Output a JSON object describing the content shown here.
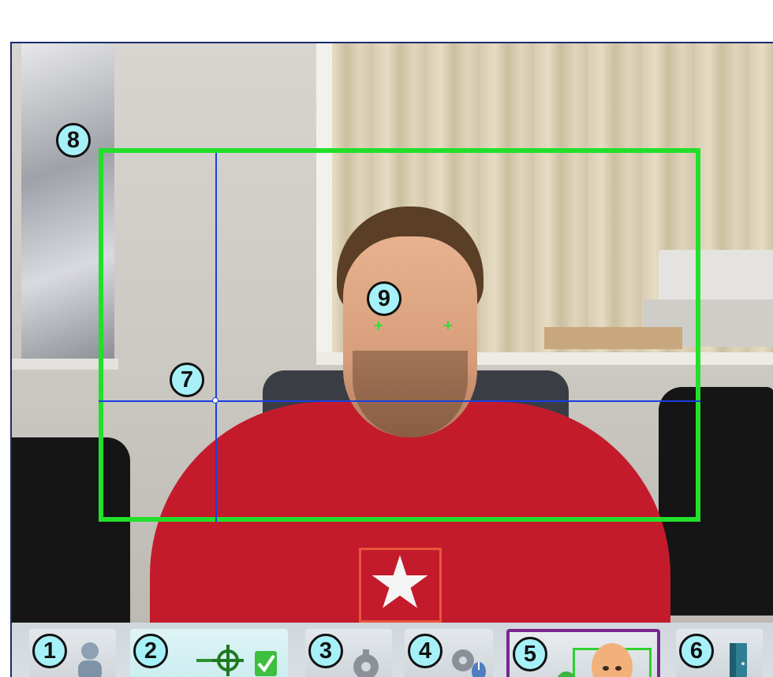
{
  "callouts": {
    "frame_region": "8",
    "eyes": "9",
    "center_point": "7"
  },
  "toolbar": {
    "buttons": [
      {
        "number": "1",
        "icon": "user-settings-icon"
      },
      {
        "number": "2",
        "icon": "calibrate-target-icon"
      },
      {
        "number": "3",
        "icon": "gear-icon"
      },
      {
        "number": "4",
        "icon": "gear-mouse-icon"
      },
      {
        "number": "5",
        "icon": "face-tracking-icon"
      },
      {
        "number": "6",
        "icon": "exit-door-icon"
      }
    ]
  },
  "colors": {
    "face_box": "#22e02a",
    "crosshair": "#1a3ee0",
    "callout_fill": "#a6f1f8",
    "active_outline": "#7a2590",
    "eye_marker": "#28e030"
  }
}
